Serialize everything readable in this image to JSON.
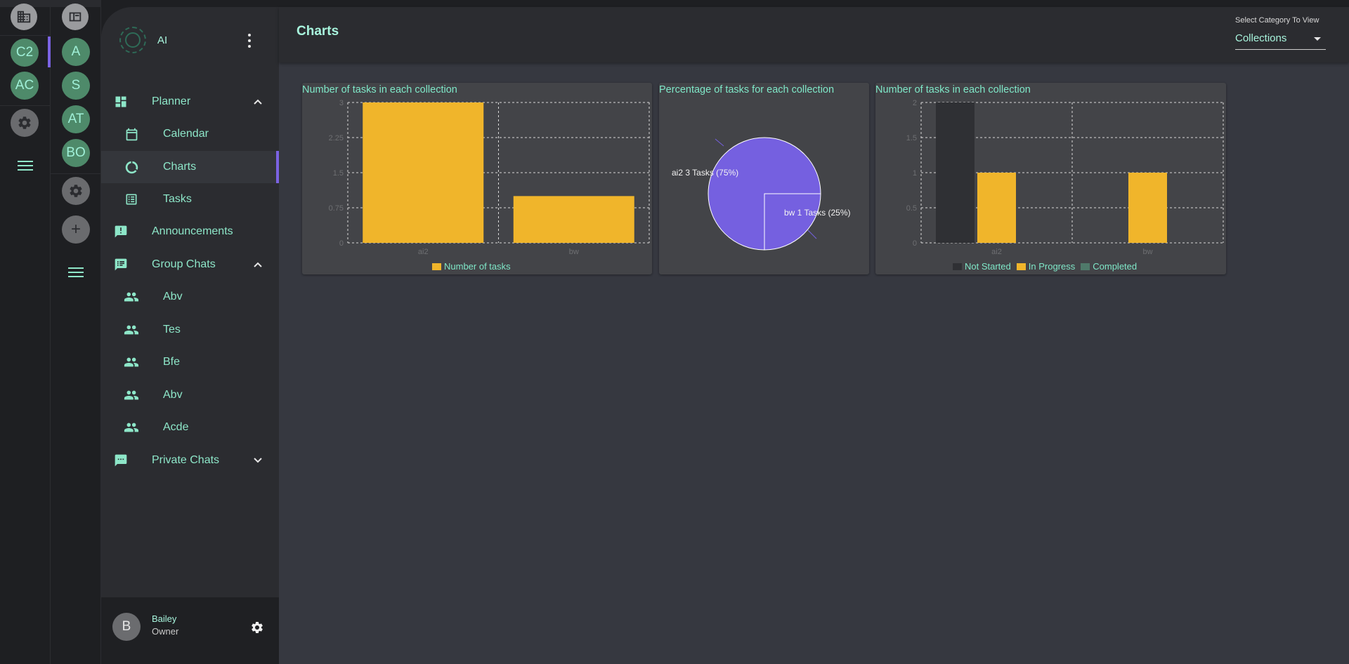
{
  "rail1": {
    "items": [
      {
        "icon": "building-icon"
      },
      {
        "initials": "C2"
      },
      {
        "initials": "AC"
      },
      {
        "icon": "gear-icon"
      },
      {
        "icon": "menu-icon"
      }
    ]
  },
  "rail2": {
    "items": [
      {
        "icon": "sidebar-toggle-icon"
      },
      {
        "initials": "A"
      },
      {
        "initials": "S"
      },
      {
        "initials": "AT"
      },
      {
        "initials": "BO"
      },
      {
        "icon": "gear-icon"
      },
      {
        "icon": "plus-icon",
        "label": "+"
      },
      {
        "icon": "menu-icon"
      }
    ]
  },
  "sidebar": {
    "workspace_name": "AI",
    "planner": {
      "label": "Planner",
      "icon": "dashboard-icon"
    },
    "planner_items": [
      {
        "label": "Calendar",
        "icon": "calendar-icon"
      },
      {
        "label": "Charts",
        "icon": "donut-chart-icon"
      },
      {
        "label": "Tasks",
        "icon": "task-list-icon"
      }
    ],
    "announcements": {
      "label": "Announcements",
      "icon": "announcement-icon"
    },
    "group_chats": {
      "label": "Group Chats",
      "icon": "forum-icon"
    },
    "group_chat_items": [
      {
        "label": "Abv",
        "icon": "people-icon"
      },
      {
        "label": "Tes",
        "icon": "people-icon"
      },
      {
        "label": "Bfe",
        "icon": "people-icon"
      },
      {
        "label": "Abv",
        "icon": "people-icon"
      },
      {
        "label": "Acde",
        "icon": "people-icon"
      }
    ],
    "private_chats": {
      "label": "Private Chats",
      "icon": "chat-icon"
    },
    "user": {
      "avatar": "B",
      "name": "Bailey",
      "role": "Owner"
    }
  },
  "header": {
    "title": "Charts",
    "select_label": "Select Category To View",
    "select_value": "Collections"
  },
  "colors": {
    "accent": "#7b63e3",
    "text_mint": "#7fe8c8",
    "bar_yellow": "#f0b52b",
    "pie_purple": "#7560e0",
    "not_started": "#2f3034",
    "completed": "#4f7a6a"
  },
  "chart_data": [
    {
      "type": "bar",
      "title": "Number of tasks in each collection",
      "categories": [
        "ai2",
        "bw"
      ],
      "y_ticks": [
        "0",
        "0.75",
        "1.5",
        "2.25",
        "3"
      ],
      "ylim": [
        0,
        3
      ],
      "series": [
        {
          "name": "Number of tasks",
          "values": [
            3,
            1
          ]
        }
      ],
      "grid": true,
      "legend": "bottom-center"
    },
    {
      "type": "pie",
      "title": "Percentage of tasks for each collection",
      "slices": [
        {
          "label": "ai2 3 Tasks (75%)",
          "value": 3,
          "percent": 75
        },
        {
          "label": "bw 1 Tasks (25%)",
          "value": 1,
          "percent": 25
        }
      ]
    },
    {
      "type": "bar",
      "title": "Number of tasks in each collection",
      "categories": [
        "ai2",
        "bw"
      ],
      "y_ticks": [
        "0",
        "0.5",
        "1",
        "1.5",
        "2"
      ],
      "ylim": [
        0,
        2
      ],
      "series": [
        {
          "name": "Not Started",
          "values": [
            2,
            0
          ]
        },
        {
          "name": "In Progress",
          "values": [
            1,
            1
          ]
        },
        {
          "name": "Completed",
          "values": [
            0,
            0
          ]
        }
      ],
      "grid": true,
      "legend": "bottom-center"
    }
  ]
}
